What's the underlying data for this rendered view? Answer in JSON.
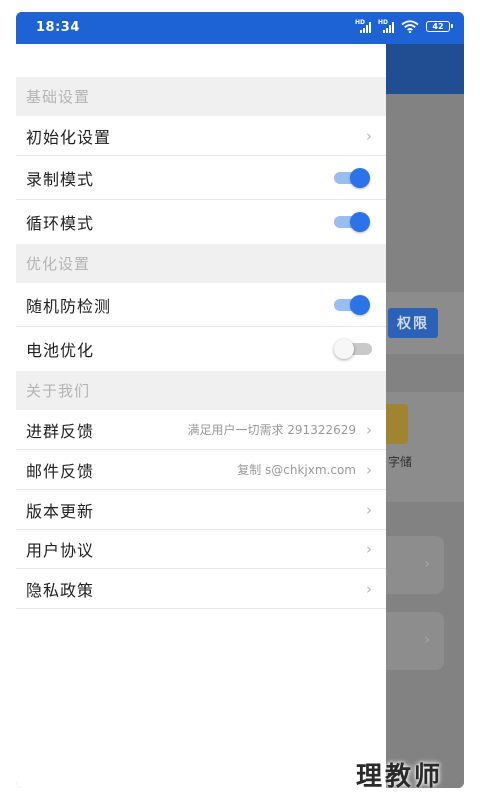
{
  "status_bar": {
    "time": "18:34",
    "signal_label": "HD",
    "battery": "42"
  },
  "drawer": {
    "sections": [
      {
        "header": "基础设置",
        "items": [
          {
            "label": "初始化设置",
            "type": "link"
          },
          {
            "label": "录制模式",
            "type": "toggle",
            "on": true
          },
          {
            "label": "循环模式",
            "type": "toggle",
            "on": true
          }
        ]
      },
      {
        "header": "优化设置",
        "items": [
          {
            "label": "随机防检测",
            "type": "toggle",
            "on": true
          },
          {
            "label": "电池优化",
            "type": "toggle",
            "on": false
          }
        ]
      },
      {
        "header": "关于我们",
        "items": [
          {
            "label": "进群反馈",
            "type": "link",
            "value": "满足用户一切需求 291322629"
          },
          {
            "label": "邮件反馈",
            "type": "link",
            "value": "复制 s@chkjxm.com"
          },
          {
            "label": "版本更新",
            "type": "link"
          },
          {
            "label": "用户协议",
            "type": "link"
          },
          {
            "label": "隐私政策",
            "type": "link"
          }
        ]
      }
    ]
  },
  "background": {
    "permission_button": "权限",
    "storage_label": "字储"
  },
  "watermark": "理教师",
  "colors": {
    "accent": "#2a73e8",
    "status_bar": "#1e63d6",
    "header_bg": "#f0f0f0"
  }
}
